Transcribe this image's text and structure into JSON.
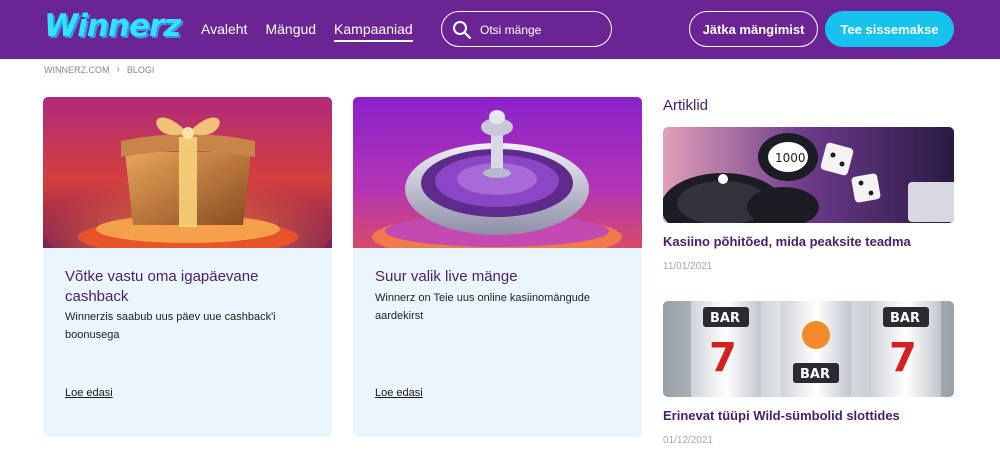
{
  "header": {
    "logo_text": "Winnerz",
    "nav": [
      {
        "label": "Avaleht",
        "active": false
      },
      {
        "label": "Mängud",
        "active": false
      },
      {
        "label": "Kampaaniad",
        "active": true
      }
    ],
    "search": {
      "placeholder": "Otsi mänge",
      "value": "",
      "icon": "search-icon"
    },
    "continue_button": "Jätka mängimist",
    "deposit_button": "Tee sissemakse"
  },
  "breadcrumb": {
    "items": [
      "WINNERZ.COM",
      "BLOGI"
    ],
    "separator": "›"
  },
  "cards": [
    {
      "image": "gift-box-image",
      "title": "Võtke vastu oma igapäevane cashback",
      "description": "Winnerzis saabub uus päev uue cashback'i boonusega",
      "link": "Loe edasi"
    },
    {
      "image": "roulette-wheel-image",
      "title": "Suur valik live mänge",
      "description": "Winnerz on Teie uus online kasiinomängude aardekirst",
      "link": "Loe edasi"
    }
  ],
  "sidebar": {
    "heading": "Artiklid",
    "articles": [
      {
        "image": "casino-chips-dice-image",
        "title": "Kasiino põhitõed, mida peaksite teadma",
        "date": "11/01/2021"
      },
      {
        "image": "slot-reels-image",
        "title": "Erinevat tüüpi Wild-sümbolid slottides",
        "date": "01/12/2021"
      }
    ]
  },
  "colors": {
    "header_bg": "#6b2494",
    "accent_cyan": "#16c3ee",
    "title_purple": "#4a1f6e",
    "card_bg": "#eaf5fd"
  }
}
